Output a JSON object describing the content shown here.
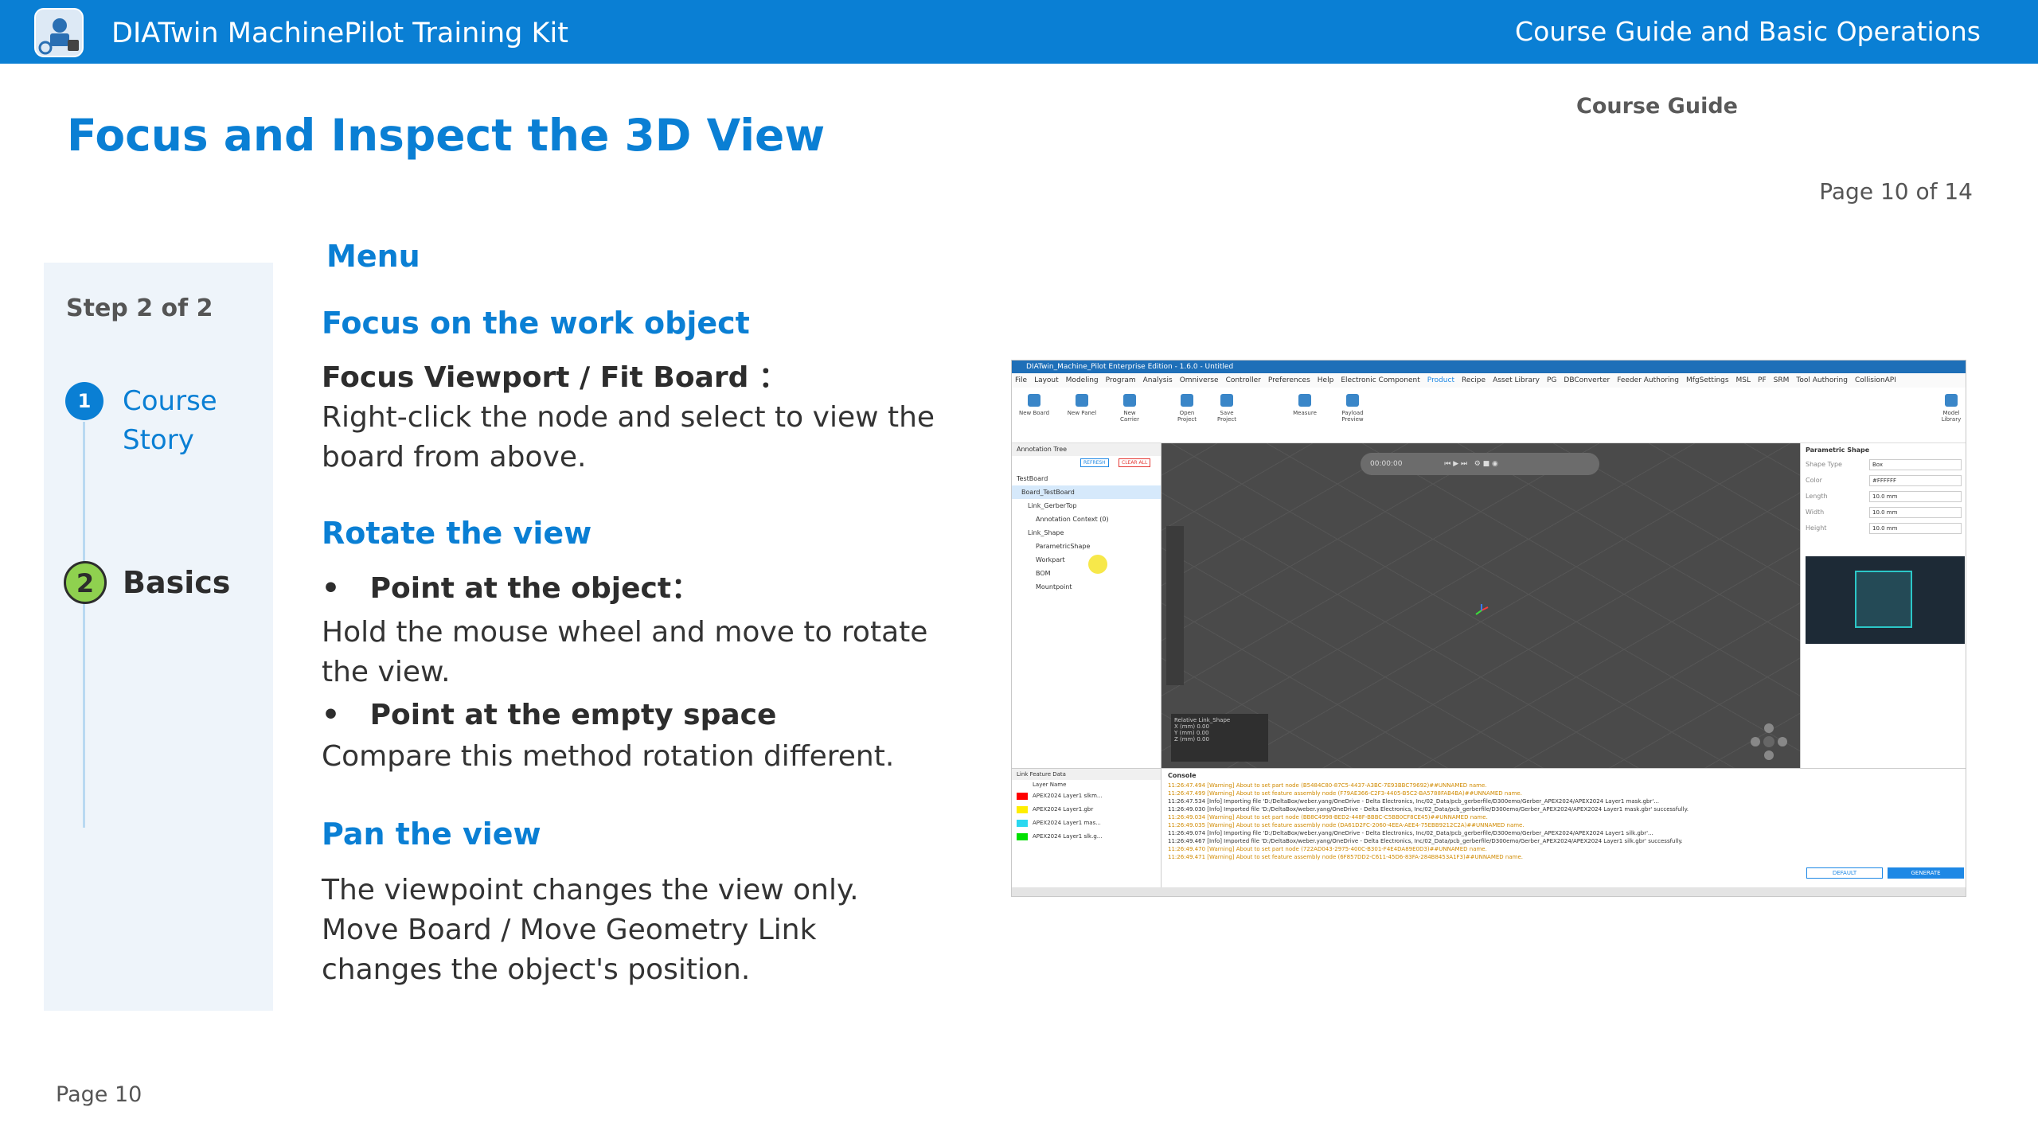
{
  "header": {
    "app_title": "DIATwin MachinePilot Training Kit",
    "section_title": "Course Guide and Basic Operations"
  },
  "page": {
    "title": "Focus and Inspect the 3D View",
    "course_guide": "Course Guide",
    "page_of": "Page 10 of 14",
    "footer_page": "Page 10"
  },
  "sidebar": {
    "step_label": "Step 2 of 2",
    "steps": [
      {
        "number": "1",
        "label": "Course Story"
      },
      {
        "number": "2",
        "label": "Basics"
      }
    ]
  },
  "content": {
    "menu_heading": "Menu",
    "focus_heading": "Focus on the work object",
    "focus_item_title": "Focus Viewport / Fit Board ：",
    "focus_item_text": "Right-click the node and select to view the board from above.",
    "rotate_heading": "Rotate the view",
    "rotate_bullet1_title": "Point at the object：",
    "rotate_bullet1_text": "Hold the mouse wheel and move to rotate the view.",
    "rotate_bullet2_title": "Point at the empty space",
    "rotate_bullet2_text": "Compare this method rotation different.",
    "pan_heading": "Pan the view",
    "pan_text": "The viewpoint changes the view only. Move Board / Move Geometry Link changes the object's position."
  },
  "screenshot": {
    "window_title": "DIATwin_Machine_Pilot Enterprise Edition - 1.6.0 - Untitled",
    "menu": [
      "File",
      "Layout",
      "Modeling",
      "Program",
      "Analysis",
      "Omniverse",
      "Controller",
      "Preferences",
      "Help",
      "Electronic Component",
      "Product",
      "Recipe",
      "Asset Library",
      "PG",
      "DBConverter",
      "Feeder Authoring",
      "MfgSettings",
      "MSL",
      "PF",
      "SRM",
      "Tool Authoring",
      "CollisionAPI"
    ],
    "active_menu": "Product",
    "ribbon": [
      "New Board",
      "New Panel",
      "New Carrier",
      "Open Project",
      "Save Project",
      "Measure",
      "Payload Preview",
      "Model Library"
    ],
    "tree_header": "Annotation Tree",
    "tree_rows": [
      "TestBoard",
      "Board_TestBoard",
      "Link_GerberTop",
      "Annotation Context (0)",
      "Link_Shape",
      "ParametricShape",
      "Workpart",
      "BOM",
      "Mountpoint"
    ],
    "refresh_label": "REFRESH",
    "clear_label": "CLEAR ALL",
    "timer": "00:00:00",
    "props_header": "Parametric Shape",
    "props": [
      {
        "label": "Shape Type",
        "value": "Box"
      },
      {
        "label": "Color",
        "value": "#FFFFFF"
      },
      {
        "label": "Length",
        "value": "10.0 mm"
      },
      {
        "label": "Width",
        "value": "10.0 mm"
      },
      {
        "label": "Height",
        "value": "10.0 mm"
      }
    ],
    "rel_panel_title": "Relative Link_Shape",
    "rel_panel_rows": [
      "X (mm)  0.00",
      "Y (mm)  0.00",
      "Z (mm)  0.00"
    ],
    "lfd_header": "Link Feature Data",
    "lfd_col": "Layer Name",
    "layers": [
      {
        "name": "APEX2024 Layer1 slkm...",
        "color": "#ff0000"
      },
      {
        "name": "APEX2024 Layer1.gbr",
        "color": "#ffee00"
      },
      {
        "name": "APEX2024 Layer1 mas...",
        "color": "#2ad8f0"
      },
      {
        "name": "APEX2024 Layer1 slk.g...",
        "color": "#00e000"
      }
    ],
    "console_header": "Console",
    "console_lines": [
      "11:26:47.494 [Warning] About to set part node (B5484C80-87C5-4437-A3BC-7E93BBC79692)##UNNAMED name.",
      "11:26:47.499 [Warning] About to set feature assembly node (F79AE366-C2F3-4405-B5C2-BA5788FAB4BA)##UNNAMED name.",
      "11:26:47.534 [Info] Importing file 'D:/DeltaBox/weber.yang/OneDrive - Delta Electronics, Inc/02_Data/pcb_gerberfile/D300emo/Gerber_APEX2024/APEX2024 Layer1 mask.gbr'...",
      "11:26:49.030 [Info] Imported file 'D:/DeltaBox/weber.yang/OneDrive - Delta Electronics, Inc/02_Data/pcb_gerberfile/D300emo/Gerber_APEX2024/APEX2024 Layer1 mask.gbr' successfully.",
      "11:26:49.034 [Warning] About to set part node (BB8C4998-BED2-448F-BBBC-C5BB0CF8CE45)##UNNAMED name.",
      "11:26:49.035 [Warning] About to set feature assembly node (DA61D2FC-2060-4EEA-AEE4-75EBB9212C2A)##UNNAMED name.",
      "11:26:49.074 [Info] Importing file 'D:/DeltaBox/weber.yang/OneDrive - Delta Electronics, Inc/02_Data/pcb_gerberfile/D300emo/Gerber_APEX2024/APEX2024 Layer1 silk.gbr'...",
      "11:26:49.467 [Info] Imported file 'D:/DeltaBox/weber.yang/OneDrive - Delta Electronics, Inc/02_Data/pcb_gerberfile/D300emo/Gerber_APEX2024/APEX2024 Layer1 silk.gbr' successfully.",
      "11:26:49.470 [Warning] About to set part node (722AD043-2975-400C-B301-F4E4DA89E0D3)##UNNAMED name.",
      "11:26:49.471 [Warning] About to set feature assembly node (6F857DD2-C611-45D6-83FA-284B8453A1F3)##UNNAMED name."
    ],
    "default_label": "DEFAULT",
    "generate_label": "GENERATE"
  },
  "colors": {
    "brand_blue": "#0a7fd4",
    "step_active": "#8fd14f",
    "sidebar_bg": "#eef4fa"
  }
}
